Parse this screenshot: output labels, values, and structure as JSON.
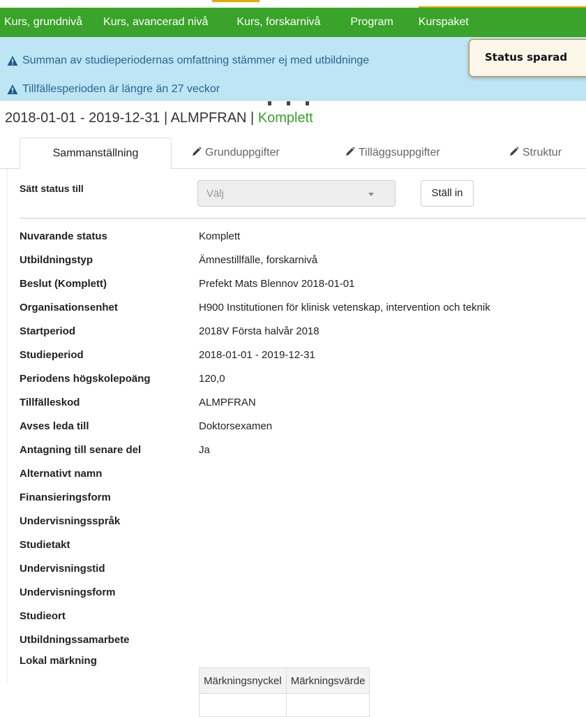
{
  "nav": {
    "items": [
      "Kurs, grundnivå",
      "Kurs, avancerad nivå",
      "Kurs, forskarnivå",
      "Program",
      "Kurspaket"
    ]
  },
  "alerts": [
    "Summan av studieperiodernas omfattning stämmer ej med utbildninge",
    "Tillfällesperioden är längre än 27 veckor"
  ],
  "toast": {
    "text": "Status sparad"
  },
  "heading": {
    "details": "2018-01-01 - 2019-12-31 | ALMPFRAN | ",
    "status": "Komplett"
  },
  "tabs": [
    "Sammanställning",
    "Grunduppgifter",
    "Tilläggsuppgifter",
    "Struktur"
  ],
  "status_form": {
    "label": "Sätt status till",
    "select_value": "Välj",
    "button_label": "Ställ in"
  },
  "details": [
    {
      "label": "Nuvarande status",
      "value": "Komplett"
    },
    {
      "label": "Utbildningstyp",
      "value": "Ämnestillfälle, forskarnivå"
    },
    {
      "label": "Beslut (Komplett)",
      "value": "Prefekt Mats Blennov 2018-01-01"
    },
    {
      "label": "Organisationsenhet",
      "value": "H900 Institutionen för klinisk vetenskap, intervention och teknik"
    },
    {
      "label": "Startperiod",
      "value": "2018V Första halvår 2018"
    },
    {
      "label": "Studieperiod",
      "value": "2018-01-01 - 2019-12-31"
    },
    {
      "label": "Periodens högskolepoäng",
      "value": "120,0"
    },
    {
      "label": "Tillfälleskod",
      "value": "ALMPFRAN"
    },
    {
      "label": "Avses leda till",
      "value": "Doktorsexamen"
    },
    {
      "label": "Antagning till senare del",
      "value": "Ja"
    },
    {
      "label": "Alternativt namn",
      "value": ""
    },
    {
      "label": "Finansieringsform",
      "value": ""
    },
    {
      "label": "Undervisningsspråk",
      "value": ""
    },
    {
      "label": "Studietakt",
      "value": ""
    },
    {
      "label": "Undervisningstid",
      "value": ""
    },
    {
      "label": "Undervisningsform",
      "value": ""
    },
    {
      "label": "Studieort",
      "value": ""
    },
    {
      "label": "Utbildningssamarbete",
      "value": ""
    },
    {
      "label": "Lokal märkning",
      "value": ""
    }
  ],
  "marking_table": {
    "headers": [
      "Märkningsnyckel",
      "Märkningsvärde"
    ]
  },
  "colors": {
    "nav_green": "#3aa329",
    "alert_bg": "#bee5f3",
    "alert_text": "#2a6496",
    "status_green": "#3a9f2a",
    "toast_border": "#b8862b"
  }
}
